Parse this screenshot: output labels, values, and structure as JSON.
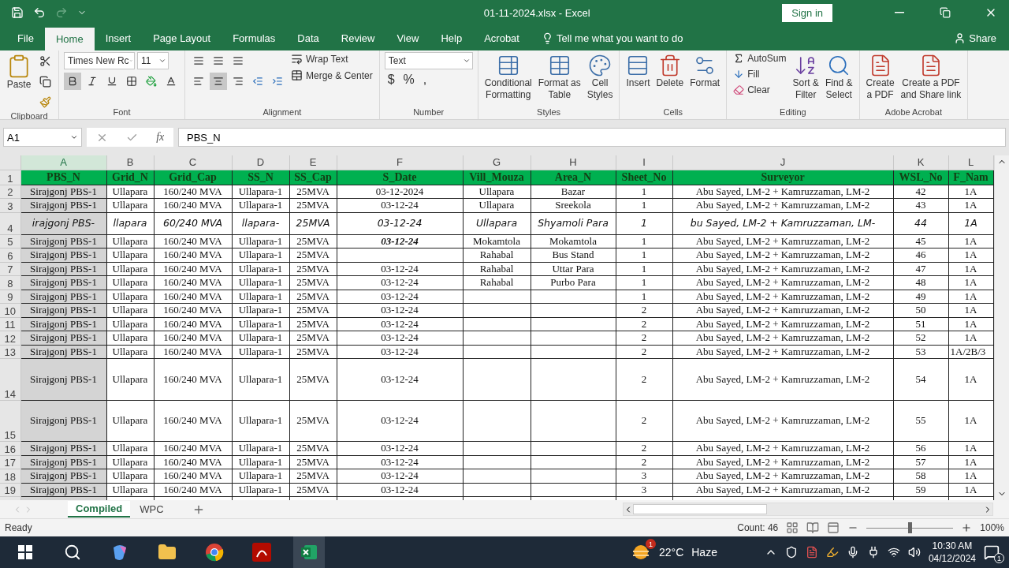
{
  "title_bar": {
    "title": "01-11-2024.xlsx  -  Excel",
    "sign_in": "Sign in"
  },
  "tabs": [
    {
      "label": "File",
      "selected": false
    },
    {
      "label": "Home",
      "selected": true
    },
    {
      "label": "Insert",
      "selected": false
    },
    {
      "label": "Page Layout",
      "selected": false
    },
    {
      "label": "Formulas",
      "selected": false
    },
    {
      "label": "Data",
      "selected": false
    },
    {
      "label": "Review",
      "selected": false
    },
    {
      "label": "View",
      "selected": false
    },
    {
      "label": "Help",
      "selected": false
    },
    {
      "label": "Acrobat",
      "selected": false
    }
  ],
  "tell_me": "Tell me what you want to do",
  "share": "Share",
  "ribbon": {
    "groups": [
      {
        "kind": "clipboard",
        "label": "Clipboard",
        "paste": "Paste"
      },
      {
        "kind": "font",
        "label": "Font",
        "font_name": "Times New Rc",
        "font_size": "11",
        "bold": true
      },
      {
        "kind": "alignment",
        "label": "Alignment",
        "wrap": "Wrap Text",
        "merge": "Merge & Center",
        "centered": true
      },
      {
        "kind": "number",
        "label": "Number",
        "format": "Text",
        "currency": "$",
        "percent": "%",
        "comma": ","
      },
      {
        "kind": "large",
        "label": "Styles",
        "buttons": [
          {
            "lines": [
              "Conditional",
              "Formatting"
            ]
          },
          {
            "lines": [
              "Format as",
              "Table"
            ]
          },
          {
            "lines": [
              "Cell",
              "Styles"
            ]
          }
        ]
      },
      {
        "kind": "large",
        "label": "Cells",
        "buttons": [
          {
            "lines": [
              "Insert"
            ]
          },
          {
            "lines": [
              "Delete"
            ]
          },
          {
            "lines": [
              "Format"
            ]
          }
        ]
      },
      {
        "kind": "editing",
        "label": "Editing",
        "autosum": "AutoSum",
        "fill": "Fill",
        "clear": "Clear",
        "buttons": [
          {
            "lines": [
              "Sort &",
              "Filter"
            ]
          },
          {
            "lines": [
              "Find &",
              "Select"
            ]
          }
        ]
      },
      {
        "kind": "large",
        "label": "Adobe Acrobat",
        "buttons": [
          {
            "lines": [
              "Create",
              "a PDF"
            ]
          },
          {
            "lines": [
              "Create a PDF",
              "and Share link"
            ]
          }
        ]
      }
    ]
  },
  "formula_bar": {
    "name_box": "A1",
    "fx": "fx",
    "value": "PBS_N"
  },
  "sheet": {
    "columns": [
      "A",
      "B",
      "C",
      "D",
      "E",
      "F",
      "G",
      "H",
      "I",
      "J",
      "K",
      "L"
    ],
    "rows": [
      {
        "number": "1",
        "kind": "header",
        "cells": [
          "PBS_N",
          "Grid_N",
          "Grid_Cap",
          "SS_N",
          "SS_Cap",
          "S_Date",
          "Vill_Mouza",
          "Area_N",
          "Sheet_No",
          "Surveyor",
          "WSL_No",
          "F_Nam"
        ]
      },
      {
        "number": "2",
        "kind": "normal",
        "cells": [
          "Sirajgonj PBS-1",
          "Ullapara",
          "160/240 MVA",
          "Ullapara-1",
          "25MVA",
          "03-12-2024",
          "Ullapara",
          "Bazar",
          "1",
          "Abu Sayed, LM-2 + Kamruzzaman, LM-2",
          "42",
          "1A"
        ]
      },
      {
        "number": "3",
        "kind": "normal",
        "cells": [
          "Sirajgonj PBS-1",
          "Ullapara",
          "160/240 MVA",
          "Ullapara-1",
          "25MVA",
          "03-12-24",
          "Ullapara",
          "Sreekola",
          "1",
          "Abu Sayed, LM-2 + Kamruzzaman, LM-2",
          "43",
          "1A"
        ]
      },
      {
        "number": "4",
        "kind": "large",
        "cells": [
          "irajgonj PBS-",
          "llapara",
          "60/240 MVA",
          "llapara-",
          "25MVA",
          "03-12-24",
          "Ullapara",
          "Shyamoli Para",
          "1",
          "bu Sayed, LM-2 + Kamruzzaman, LM-",
          "44",
          "1A"
        ]
      },
      {
        "number": "5",
        "kind": "normal",
        "cells": [
          "Sirajgonj PBS-1",
          "Ullapara",
          "160/240 MVA",
          "Ullapara-1",
          "25MVA",
          {
            "text": "03-12-24",
            "bold_italic": true
          },
          "Mokamtola",
          "Mokamtola",
          "1",
          "Abu Sayed, LM-2 + Kamruzzaman, LM-2",
          "45",
          "1A"
        ]
      },
      {
        "number": "6",
        "kind": "normal",
        "cells": [
          "Sirajgonj PBS-1",
          "Ullapara",
          "160/240 MVA",
          "Ullapara-1",
          "25MVA",
          null,
          "Rahabal",
          "Bus Stand",
          "1",
          "Abu Sayed, LM-2 + Kamruzzaman, LM-2",
          "46",
          "1A"
        ]
      },
      {
        "number": "7",
        "kind": "normal",
        "cells": [
          "Sirajgonj PBS-1",
          "Ullapara",
          "160/240 MVA",
          "Ullapara-1",
          "25MVA",
          "03-12-24",
          "Rahabal",
          "Uttar Para",
          "1",
          "Abu Sayed, LM-2 + Kamruzzaman, LM-2",
          "47",
          "1A"
        ]
      },
      {
        "number": "8",
        "kind": "normal",
        "cells": [
          "Sirajgonj PBS-1",
          "Ullapara",
          "160/240 MVA",
          "Ullapara-1",
          "25MVA",
          "03-12-24",
          "Rahabal",
          "Purbo Para",
          "1",
          "Abu Sayed, LM-2 + Kamruzzaman, LM-2",
          "48",
          "1A"
        ]
      },
      {
        "number": "9",
        "kind": "normal",
        "cells": [
          "Sirajgonj PBS-1",
          "Ullapara",
          "160/240 MVA",
          "Ullapara-1",
          "25MVA",
          "03-12-24",
          null,
          null,
          "1",
          "Abu Sayed, LM-2 + Kamruzzaman, LM-2",
          "49",
          "1A"
        ]
      },
      {
        "number": "10",
        "kind": "normal",
        "cells": [
          "Sirajgonj PBS-1",
          "Ullapara",
          "160/240 MVA",
          "Ullapara-1",
          "25MVA",
          "03-12-24",
          null,
          null,
          "2",
          "Abu Sayed, LM-2 + Kamruzzaman, LM-2",
          "50",
          "1A"
        ]
      },
      {
        "number": "11",
        "kind": "normal",
        "cells": [
          "Sirajgonj PBS-1",
          "Ullapara",
          "160/240 MVA",
          "Ullapara-1",
          "25MVA",
          "03-12-24",
          null,
          null,
          "2",
          "Abu Sayed, LM-2 + Kamruzzaman, LM-2",
          "51",
          "1A"
        ]
      },
      {
        "number": "12",
        "kind": "normal",
        "cells": [
          "Sirajgonj PBS-1",
          "Ullapara",
          "160/240 MVA",
          "Ullapara-1",
          "25MVA",
          "03-12-24",
          null,
          null,
          "2",
          "Abu Sayed, LM-2 + Kamruzzaman, LM-2",
          "52",
          "1A"
        ]
      },
      {
        "number": "13",
        "kind": "normal",
        "cells": [
          "Sirajgonj PBS-1",
          "Ullapara",
          "160/240 MVA",
          "Ullapara-1",
          "25MVA",
          "03-12-24",
          null,
          null,
          "2",
          "Abu Sayed, LM-2 + Kamruzzaman, LM-2",
          "53",
          "1A/2B/3"
        ]
      },
      {
        "number": "14",
        "kind": "tall",
        "cells": [
          "Sirajgonj PBS-1",
          "Ullapara",
          "160/240 MVA",
          "Ullapara-1",
          "25MVA",
          "03-12-24",
          null,
          null,
          "2",
          "Abu Sayed, LM-2 + Kamruzzaman, LM-2",
          "54",
          "1A"
        ]
      },
      {
        "number": "15",
        "kind": "tall",
        "cells": [
          "Sirajgonj PBS-1",
          "Ullapara",
          "160/240 MVA",
          "Ullapara-1",
          "25MVA",
          "03-12-24",
          null,
          null,
          "2",
          "Abu Sayed, LM-2 + Kamruzzaman, LM-2",
          "55",
          "1A"
        ]
      },
      {
        "number": "16",
        "kind": "normal",
        "cells": [
          "Sirajgonj PBS-1",
          "Ullapara",
          "160/240 MVA",
          "Ullapara-1",
          "25MVA",
          "03-12-24",
          null,
          null,
          "2",
          "Abu Sayed, LM-2 + Kamruzzaman, LM-2",
          "56",
          "1A"
        ]
      },
      {
        "number": "17",
        "kind": "normal",
        "cells": [
          "Sirajgonj PBS-1",
          "Ullapara",
          "160/240 MVA",
          "Ullapara-1",
          "25MVA",
          "03-12-24",
          null,
          null,
          "2",
          "Abu Sayed, LM-2 + Kamruzzaman, LM-2",
          "57",
          "1A"
        ]
      },
      {
        "number": "18",
        "kind": "normal",
        "cells": [
          "Sirajgonj PBS-1",
          "Ullapara",
          "160/240 MVA",
          "Ullapara-1",
          "25MVA",
          "03-12-24",
          null,
          null,
          "3",
          "Abu Sayed, LM-2 + Kamruzzaman, LM-2",
          "58",
          "1A"
        ]
      },
      {
        "number": "19",
        "kind": "normal",
        "cells": [
          "Sirajgonj PBS-1",
          "Ullapara",
          "160/240 MVA",
          "Ullapara-1",
          "25MVA",
          "03-12-24",
          null,
          null,
          "3",
          "Abu Sayed, LM-2 + Kamruzzaman, LM-2",
          "59",
          "1A"
        ]
      }
    ]
  },
  "sheet_tabs": [
    {
      "label": "Compiled",
      "selected": true
    },
    {
      "label": "WPC",
      "selected": false
    }
  ],
  "status_bar": {
    "status": "Ready",
    "count": "Count: 46",
    "zoom": "100%",
    "zoom_slider": {
      "level": 0.5
    }
  },
  "taskbar": {
    "weather_badge": "1",
    "temperature": "22°C",
    "weather": "Haze",
    "time": "10:30 AM",
    "date": "04/12/2024",
    "notifications": "1"
  }
}
